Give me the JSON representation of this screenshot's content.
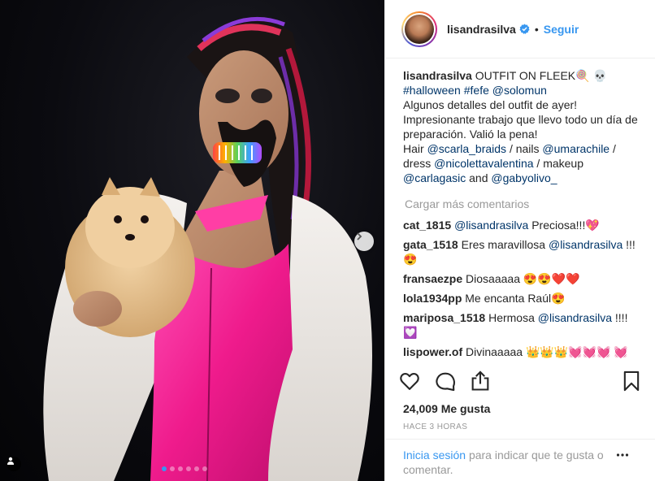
{
  "post": {
    "username": "lisandrasilva",
    "follow_label": "Seguir",
    "dot": "•",
    "caption_parts": {
      "title": "OUTFIT ON FLEEK🍭 💀",
      "hashtag1": "#halloween",
      "hashtag2": "#fefe",
      "mention1": "@solomun",
      "text1": "Algunos detalles del outfit de ayer! Impresionante trabajo que llevo todo un día de preparación. Valió la pena!",
      "hair_label": "Hair",
      "hair_handle": "@scarla_braids",
      "nails_label": "/ nails",
      "nails_handle": "@umarachile",
      "slash1": "/",
      "dress_label": "dress",
      "dress_handle": "@nicolettavalentina",
      "makeup_label": "/ makeup",
      "makeup_handle": "@carlagasic",
      "and": "and",
      "last_handle": "@gabyolivo_"
    },
    "load_more": "Cargar más comentarios",
    "comments": [
      {
        "user": "cat_1815",
        "mention": "@lisandrasilva",
        "text": "Preciosa!!!💖"
      },
      {
        "user": "gata_1518",
        "text": "Eres maravillosa",
        "mention": "@lisandrasilva",
        "tail": "!!!😍"
      },
      {
        "user": "fransaezpe",
        "text": "Diosaaaaa 😍😍❤️❤️"
      },
      {
        "user": "lola1934pp",
        "text": "Me encanta Raúl😍"
      },
      {
        "user": "mariposa_1518",
        "text": "Hermosa",
        "mention": "@lisandrasilva",
        "tail": "!!!! 💟"
      },
      {
        "user": "lispower.of",
        "text": "Divinaaaaa 👑👑👑💓💓💓 💓💓💓💓"
      }
    ],
    "likes": "24,009 Me gusta",
    "timestamp": "HACE 3 HORAS",
    "login_link": "Inicia sesión",
    "login_text": "para indicar que te gusta o comentar."
  },
  "icons": {
    "like": "heart-icon",
    "comment": "comment-icon",
    "share": "share-icon",
    "save": "bookmark-icon",
    "more": "more-options-icon",
    "verified": "verified-badge-icon",
    "next": "chevron-right-icon",
    "tag": "person-tag-icon"
  },
  "carousel": {
    "count": 6,
    "active_index": 0
  },
  "colors": {
    "accent": "#3897f0",
    "link": "#003569",
    "muted": "#999999"
  }
}
